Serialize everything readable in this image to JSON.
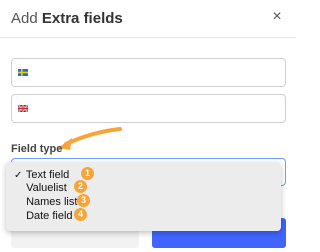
{
  "dialog": {
    "title_prefix": "Add",
    "title_strong": "Extra fields",
    "close_glyph": "×"
  },
  "inputs": [
    {
      "flag": "sweden-flag-icon",
      "value": ""
    },
    {
      "flag": "uk-flag-icon",
      "value": ""
    }
  ],
  "field_type": {
    "label": "Field type",
    "options": [
      "Text field",
      "Valuelist",
      "Names list",
      "Date field"
    ],
    "selected_index": 0,
    "check_glyph": "✓",
    "badges": [
      "1",
      "2",
      "3",
      "4"
    ]
  },
  "colors": {
    "accent": "#3f64ff",
    "badge": "#f7a538",
    "focus_border": "#6aa0ff",
    "arrow": "#f7a538"
  },
  "icons": {
    "close": "close-icon",
    "arrow": "annotation-arrow-icon",
    "caret": "chevron-down-icon"
  }
}
